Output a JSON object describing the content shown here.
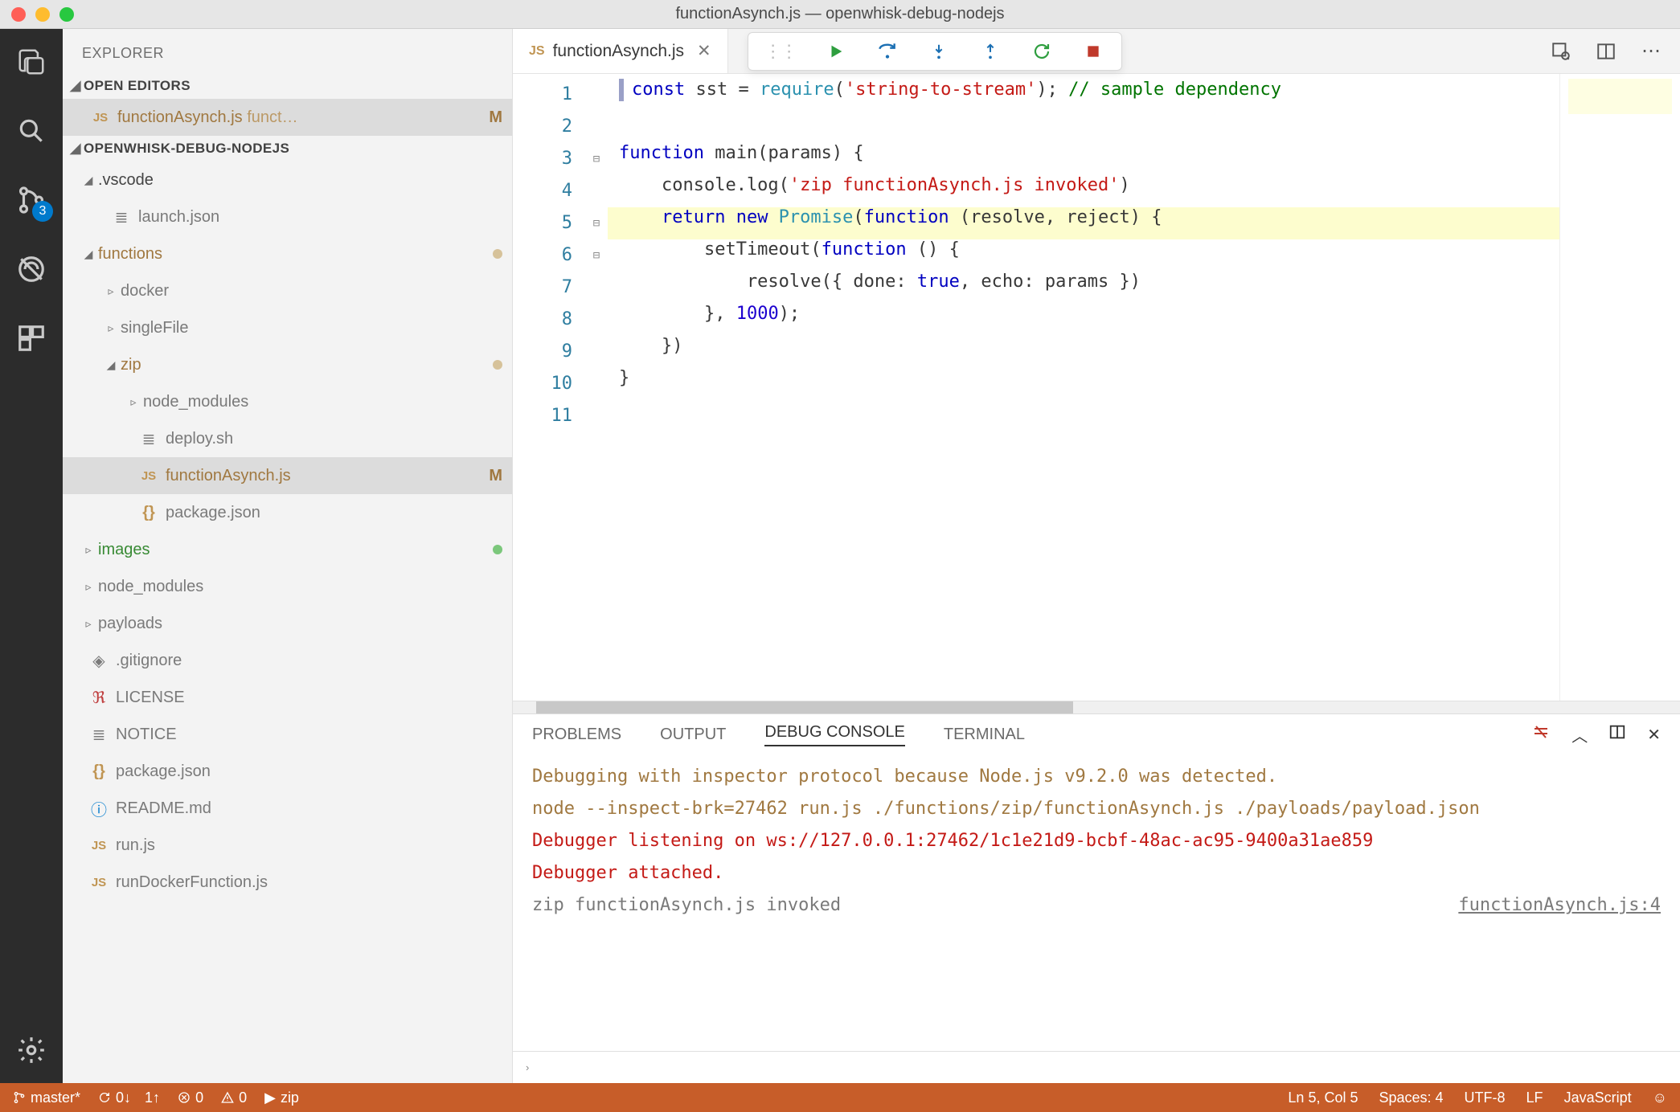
{
  "window": {
    "title": "functionAsynch.js — openwhisk-debug-nodejs"
  },
  "activitybar": {
    "scm_badge": "3"
  },
  "explorer": {
    "title": "EXPLORER",
    "open_editors_label": "OPEN EDITORS",
    "open_editor_file": "functionAsynch.js",
    "open_editor_folder": "funct…",
    "open_editor_status": "M",
    "project_label": "OPENWHISK-DEBUG-NODEJS",
    "tree": {
      "vscode": ".vscode",
      "launch": "launch.json",
      "functions": "functions",
      "docker": "docker",
      "singleFile": "singleFile",
      "zip": "zip",
      "node_modules_zip": "node_modules",
      "deploy": "deploy.sh",
      "functionAsynch": "functionAsynch.js",
      "functionAsynch_status": "M",
      "package_zip": "package.json",
      "images": "images",
      "node_modules_root": "node_modules",
      "payloads": "payloads",
      "gitignore": ".gitignore",
      "license": "LICENSE",
      "notice": "NOTICE",
      "package_root": "package.json",
      "readme": "README.md",
      "runjs": "run.js",
      "runDocker": "runDockerFunction.js"
    }
  },
  "tab": {
    "filename": "functionAsynch.js",
    "js_badge": "JS"
  },
  "code": {
    "lines": [
      "1",
      "2",
      "3",
      "4",
      "5",
      "6",
      "7",
      "8",
      "9",
      "10",
      "11"
    ],
    "l1_a": "const",
    "l1_b": " sst = ",
    "l1_c": "require",
    "l1_d": "(",
    "l1_e": "'string-to-stream'",
    "l1_f": "); ",
    "l1_g": "// sample dependency",
    "l3_a": "function",
    "l3_b": " main(params) {",
    "l4_a": "    console.log(",
    "l4_b": "'zip functionAsynch.js invoked'",
    "l4_c": ")",
    "l5_a": "    ",
    "l5_b": "return new",
    "l5_c": " Promise",
    "l5_d": "(",
    "l5_e": "function",
    "l5_f": " (resolve, reject) {",
    "l6_a": "        setTimeout(",
    "l6_b": "function",
    "l6_c": " () {",
    "l7_a": "            resolve({ done: ",
    "l7_b": "true",
    "l7_c": ", echo: params })",
    "l8_a": "        }, ",
    "l8_b": "1000",
    "l8_c": ");",
    "l9": "    })",
    "l10": "}"
  },
  "panel": {
    "tabs": {
      "problems": "PROBLEMS",
      "output": "OUTPUT",
      "debug": "DEBUG CONSOLE",
      "terminal": "TERMINAL"
    },
    "line1": "Debugging with inspector protocol because Node.js v9.2.0 was detected.",
    "line2": "node --inspect-brk=27462 run.js ./functions/zip/functionAsynch.js ./payloads/payload.json",
    "line3": "Debugger listening on ws://127.0.0.1:27462/1c1e21d9-bcbf-48ac-ac95-9400a31ae859",
    "line4": "Debugger attached.",
    "line5": "zip functionAsynch.js invoked",
    "line5_src": "functionAsynch.js:4",
    "input_prompt": "›"
  },
  "status": {
    "branch": "master*",
    "sync_down": "0↓",
    "sync_up": "1↑",
    "errors": "0",
    "warnings": "0",
    "debug_target": "zip",
    "cursor": "Ln 5, Col 5",
    "spaces": "Spaces: 4",
    "encoding": "UTF-8",
    "eol": "LF",
    "lang": "JavaScript"
  }
}
